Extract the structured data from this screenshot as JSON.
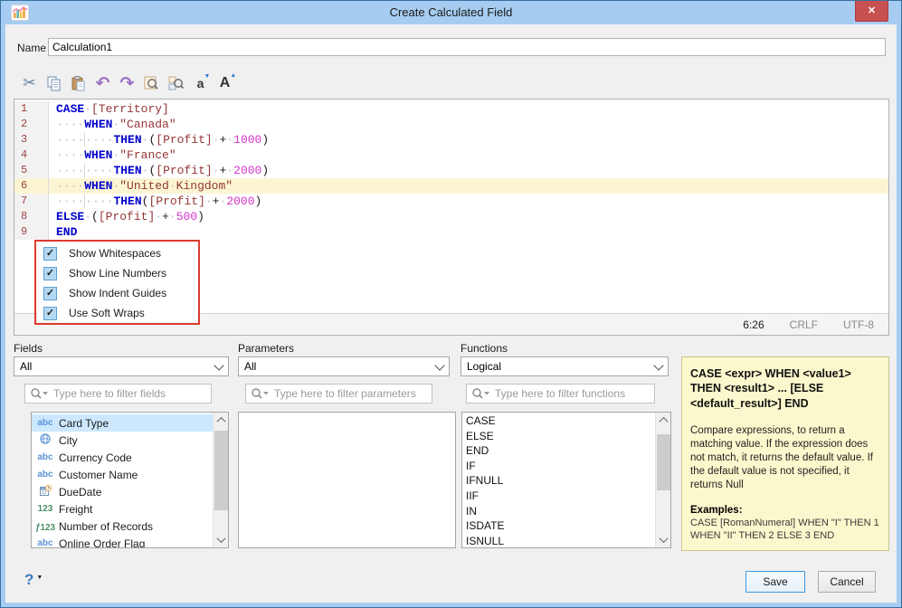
{
  "window": {
    "title": "Create Calculated Field",
    "close_glyph": "✕"
  },
  "name_row": {
    "label": "Name",
    "value": "Calculation1"
  },
  "toolbar": {
    "icons": [
      "cut",
      "copy",
      "paste",
      "undo",
      "redo",
      "find",
      "find-replace",
      "font-decrease",
      "font-increase"
    ]
  },
  "editor": {
    "lines": [
      {
        "no": "1",
        "current": false,
        "tokens": [
          [
            "kw",
            "CASE"
          ],
          [
            "ws",
            "·"
          ],
          [
            "fld",
            "[Territory]"
          ]
        ]
      },
      {
        "no": "2",
        "current": false,
        "tokens": [
          [
            "ws",
            "····"
          ],
          [
            "kw",
            "WHEN"
          ],
          [
            "ws",
            "·"
          ],
          [
            "str",
            "\"Canada\""
          ]
        ]
      },
      {
        "no": "3",
        "current": false,
        "tokens": [
          [
            "ws",
            "····"
          ],
          [
            "wsg",
            "····"
          ],
          [
            "kw",
            "THEN"
          ],
          [
            "ws",
            "·"
          ],
          [
            "pl",
            "("
          ],
          [
            "fld",
            "[Profit]"
          ],
          [
            "ws",
            "·"
          ],
          [
            "op",
            "+"
          ],
          [
            "ws",
            "·"
          ],
          [
            "num",
            "1000"
          ],
          [
            "pl",
            ")"
          ]
        ]
      },
      {
        "no": "4",
        "current": false,
        "tokens": [
          [
            "ws",
            "····"
          ],
          [
            "kw",
            "WHEN"
          ],
          [
            "ws",
            "·"
          ],
          [
            "str",
            "\"France\""
          ]
        ]
      },
      {
        "no": "5",
        "current": false,
        "tokens": [
          [
            "ws",
            "····"
          ],
          [
            "wsg",
            "····"
          ],
          [
            "kw",
            "THEN"
          ],
          [
            "ws",
            "·"
          ],
          [
            "pl",
            "("
          ],
          [
            "fld",
            "[Profit]"
          ],
          [
            "ws",
            "·"
          ],
          [
            "op",
            "+"
          ],
          [
            "ws",
            "·"
          ],
          [
            "num",
            "2000"
          ],
          [
            "pl",
            ")"
          ]
        ]
      },
      {
        "no": "6",
        "current": true,
        "tokens": [
          [
            "ws",
            "····"
          ],
          [
            "kw",
            "WHEN"
          ],
          [
            "ws",
            "·"
          ],
          [
            "str",
            "\"United"
          ],
          [
            "ws",
            "·"
          ],
          [
            "str",
            "Kingdom\""
          ]
        ]
      },
      {
        "no": "7",
        "current": false,
        "tokens": [
          [
            "ws",
            "····"
          ],
          [
            "wsg",
            "····"
          ],
          [
            "kw",
            "THEN"
          ],
          [
            "pl",
            "("
          ],
          [
            "fld",
            "[Profit]"
          ],
          [
            "ws",
            "·"
          ],
          [
            "op",
            "+"
          ],
          [
            "ws",
            "·"
          ],
          [
            "num",
            "2000"
          ],
          [
            "pl",
            ")"
          ]
        ]
      },
      {
        "no": "8",
        "current": false,
        "tokens": [
          [
            "kw",
            "ELSE"
          ],
          [
            "ws",
            "·"
          ],
          [
            "pl",
            "("
          ],
          [
            "fld",
            "[Profit]"
          ],
          [
            "ws",
            "·"
          ],
          [
            "op",
            "+"
          ],
          [
            "ws",
            "·"
          ],
          [
            "num",
            "500"
          ],
          [
            "pl",
            ")"
          ]
        ]
      },
      {
        "no": "9",
        "current": false,
        "tokens": [
          [
            "kw",
            "END"
          ]
        ]
      }
    ],
    "status": {
      "position": "6:26",
      "line_ending": "CRLF",
      "encoding": "UTF-8"
    }
  },
  "context_menu": {
    "items": [
      {
        "label": "Show Whitespaces",
        "checked": true
      },
      {
        "label": "Show Line Numbers",
        "checked": true
      },
      {
        "label": "Show Indent Guides",
        "checked": true
      },
      {
        "label": "Use Soft Wraps",
        "checked": true
      }
    ],
    "check_glyph": "✓"
  },
  "panels": {
    "fields": {
      "label": "Fields",
      "dropdown_value": "All",
      "filter_placeholder": "Type here to filter fields",
      "items": [
        {
          "icon": "abc",
          "label": "Card Type",
          "selected": true
        },
        {
          "icon": "globe",
          "label": "City",
          "selected": false
        },
        {
          "icon": "abc",
          "label": "Currency Code",
          "selected": false
        },
        {
          "icon": "abc",
          "label": "Customer Name",
          "selected": false
        },
        {
          "icon": "datetime",
          "label": "DueDate",
          "selected": false
        },
        {
          "icon": "number",
          "label": "Freight",
          "selected": false
        },
        {
          "icon": "calc-number",
          "label": "Number of Records",
          "selected": false
        },
        {
          "icon": "abc",
          "label": "Online Order Flag",
          "selected": false
        }
      ]
    },
    "parameters": {
      "label": "Parameters",
      "dropdown_value": "All",
      "filter_placeholder": "Type here to filter parameters",
      "items": []
    },
    "functions": {
      "label": "Functions",
      "dropdown_value": "Logical",
      "filter_placeholder": "Type here to filter functions",
      "items": [
        "CASE",
        "ELSE",
        "END",
        "IF",
        "IFNULL",
        "IIF",
        "IN",
        "ISDATE",
        "ISNULL"
      ]
    }
  },
  "help_panel": {
    "signature": "CASE <expr> WHEN <value1> THEN <result1> ... [ELSE <default_result>] END",
    "description": "Compare expressions, to return a matching value. If the expression does not match, it returns the default value. If the default value is not specified, it returns Null",
    "examples_label": "Examples:",
    "example": "CASE [RomanNumeral] WHEN \"I\" THEN 1 WHEN \"II\" THEN 2 ELSE 3 END"
  },
  "footer": {
    "save_label": "Save",
    "cancel_label": "Cancel"
  },
  "colors": {
    "titlebar": "#a6cdf1",
    "close_button": "#c75050",
    "keyword": "#0000cc",
    "field_ref": "#943634",
    "number_literal": "#d633c9",
    "current_line": "#fbf5d3",
    "annotation_red": "#dd3b2f",
    "selection_blue": "#cbe8ff",
    "help_panel_bg": "#fcf8cd"
  }
}
